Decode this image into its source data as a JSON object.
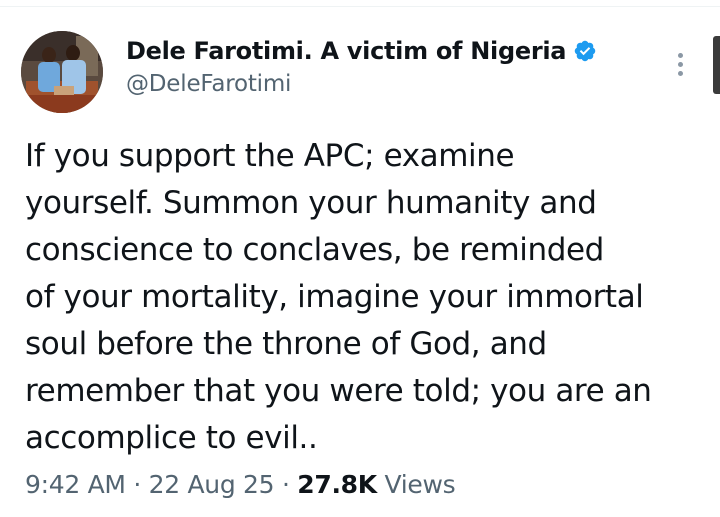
{
  "tweet": {
    "author": {
      "display_name": "Dele Farotimi. A victim of Nigeria",
      "handle": "@DeleFarotimi",
      "verified": true
    },
    "text_lines": [
      "If you support the APC; examine",
      "yourself. Summon your humanity and",
      "conscience to conclaves, be reminded",
      "of your mortality, imagine your immortal",
      "soul before the throne of God, and",
      "remember that you were told; you are an",
      "accomplice to evil.."
    ],
    "time": "9:42 AM",
    "date": "22 Aug 25",
    "separator": "·",
    "views_count": "27.8K",
    "views_label": "Views"
  },
  "icons": {
    "verified": "verified-badge-icon",
    "more": "more-vertical-icon"
  },
  "colors": {
    "verified_blue": "#1d9bf0",
    "text_primary": "#0f1419",
    "text_secondary": "#536471"
  }
}
